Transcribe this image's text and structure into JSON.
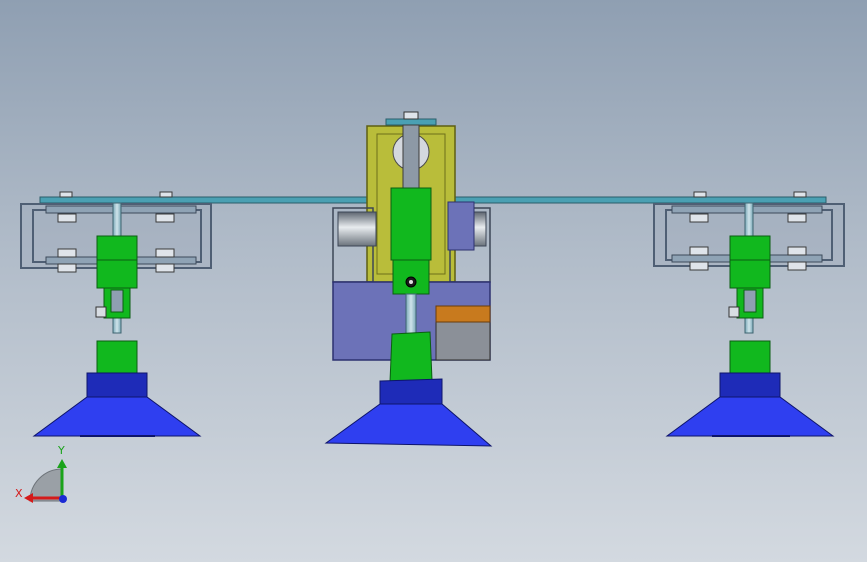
{
  "viewport": {
    "background_top": "#8f9fb2",
    "background_bottom": "#d3d9e0"
  },
  "axes": {
    "x_label": "X",
    "y_label": "Y",
    "x_color": "#d41a1a",
    "y_color": "#1aa31a",
    "z_color": "#1a2ad4"
  },
  "colors": {
    "cup_blue": "#2f3ff0",
    "cup_dark": "#1e2bb8",
    "green": "#11b81e",
    "olive": "#b9bd3a",
    "lavender": "#6c72b8",
    "orange": "#c87a1e",
    "rail": "#4aa0b3",
    "steel": "#8d99a6",
    "frame": "#5b6c82"
  }
}
